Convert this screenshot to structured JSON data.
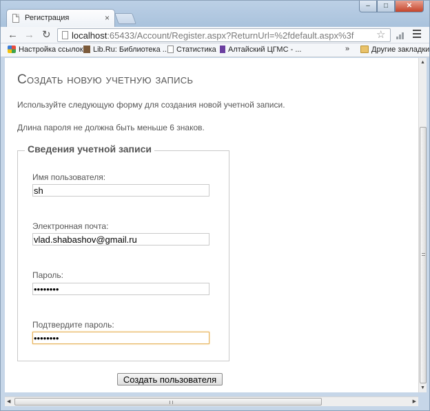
{
  "browser": {
    "tab_title": "Регистрация",
    "url_host": "localhost",
    "url_rest": ":65433/Account/Register.aspx?ReturnUrl=%2fdefault.aspx%3f",
    "bookmarks": [
      {
        "label": "Настройка ссылок",
        "icon": "windows-icon"
      },
      {
        "label": "Lib.Ru: Библиотека ...",
        "icon": "lib-icon"
      },
      {
        "label": "Статистика",
        "icon": "page-icon"
      },
      {
        "label": "Алтайский ЦГМС - ...",
        "icon": "altai-icon"
      }
    ],
    "more_bookmarks": "»",
    "other_bookmarks": "Другие закладки"
  },
  "page": {
    "title": "Создать новую учетную запись",
    "intro_1": "Используйте следующую форму для создания новой учетной записи.",
    "intro_2": "Длина пароля не должна быть меньше 6 знаков.",
    "legend": "Сведения учетной записи",
    "fields": {
      "username": {
        "label": "Имя пользователя:",
        "value": "sh"
      },
      "email": {
        "label": "Электронная почта:",
        "value": "vlad.shabashov@gmail.ru"
      },
      "password": {
        "label": "Пароль:",
        "value": "••••••••"
      },
      "confirm": {
        "label": "Подтвердите пароль:",
        "value": "••••••••"
      }
    },
    "submit_label": "Создать пользователя"
  },
  "colors": {
    "focus_border": "#e6b25a",
    "text": "#555555"
  }
}
